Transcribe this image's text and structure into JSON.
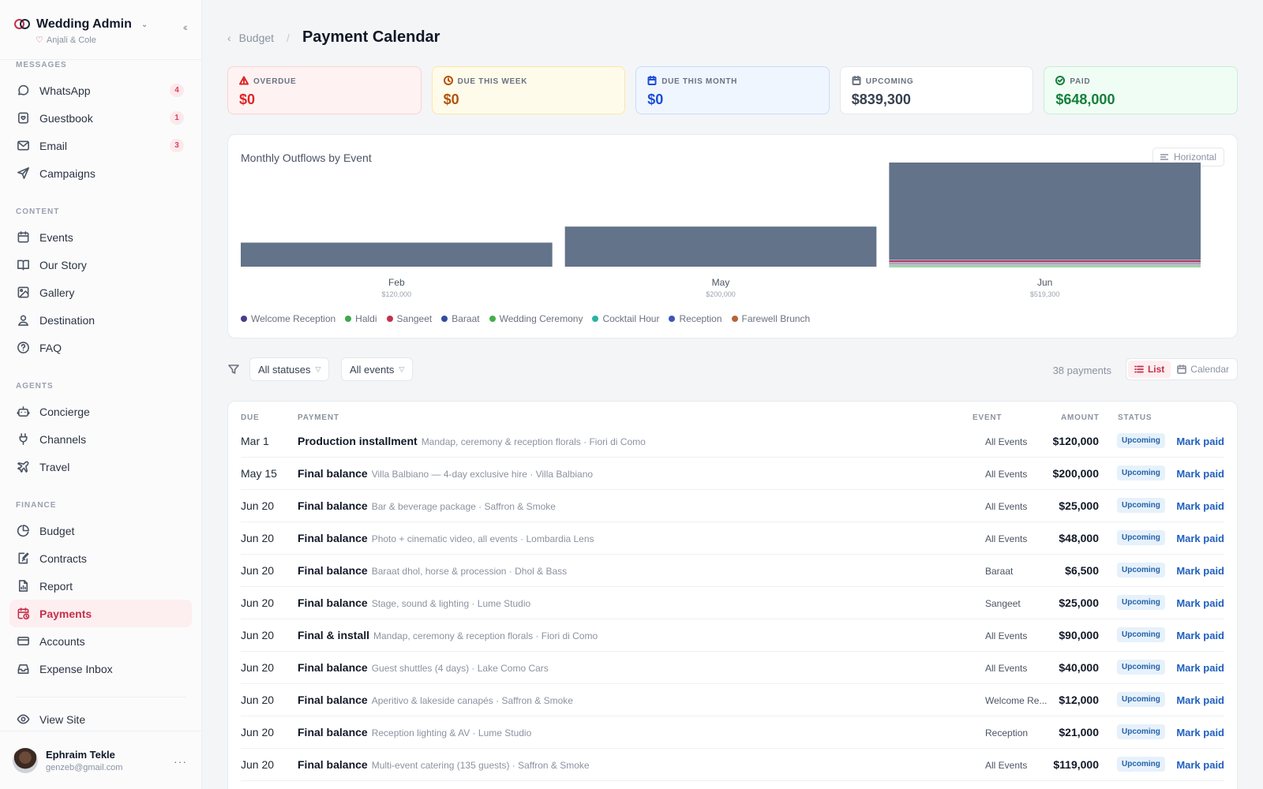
{
  "sidebar": {
    "brand": "Wedding Admin",
    "couple": "Anjali & Cole",
    "sections": [
      {
        "label": "MESSAGES",
        "items": [
          {
            "label": "WhatsApp",
            "icon": "message-circle-icon",
            "badge": "4"
          },
          {
            "label": "Guestbook",
            "icon": "guestbook-icon",
            "badge": "1"
          },
          {
            "label": "Email",
            "icon": "mail-icon",
            "badge": "3"
          },
          {
            "label": "Campaigns",
            "icon": "send-icon"
          }
        ]
      },
      {
        "label": "CONTENT",
        "items": [
          {
            "label": "Events",
            "icon": "calendar-icon"
          },
          {
            "label": "Our Story",
            "icon": "book-icon"
          },
          {
            "label": "Gallery",
            "icon": "image-icon"
          },
          {
            "label": "Destination",
            "icon": "map-pin-icon"
          },
          {
            "label": "FAQ",
            "icon": "help-circle-icon"
          }
        ]
      },
      {
        "label": "AGENTS",
        "items": [
          {
            "label": "Concierge",
            "icon": "bot-icon"
          },
          {
            "label": "Channels",
            "icon": "plug-icon"
          },
          {
            "label": "Travel",
            "icon": "plane-icon"
          }
        ]
      },
      {
        "label": "FINANCE",
        "items": [
          {
            "label": "Budget",
            "icon": "pie-chart-icon"
          },
          {
            "label": "Contracts",
            "icon": "file-signature-icon"
          },
          {
            "label": "Report",
            "icon": "file-chart-icon"
          },
          {
            "label": "Payments",
            "icon": "calendar-clock-icon",
            "active": true
          },
          {
            "label": "Accounts",
            "icon": "credit-card-icon"
          },
          {
            "label": "Expense Inbox",
            "icon": "inbox-icon"
          }
        ]
      }
    ],
    "view_site": "View Site",
    "user": {
      "name": "Ephraim Tekle",
      "email": "genzeb@gmail.com"
    }
  },
  "header": {
    "breadcrumb": "Budget",
    "title": "Payment Calendar"
  },
  "stats": [
    {
      "key": "overdue",
      "label": "OVERDUE",
      "value": "$0",
      "icon": "alert-triangle-icon"
    },
    {
      "key": "week",
      "label": "DUE THIS WEEK",
      "value": "$0",
      "icon": "clock-icon"
    },
    {
      "key": "month",
      "label": "DUE THIS MONTH",
      "value": "$0",
      "icon": "calendar-icon"
    },
    {
      "key": "upcoming",
      "label": "UPCOMING",
      "value": "$839,300",
      "icon": "calendar-icon"
    },
    {
      "key": "paid",
      "label": "PAID",
      "value": "$648,000",
      "icon": "check-circle-icon"
    }
  ],
  "chart": {
    "title": "Monthly Outflows by Event",
    "orientation_label": "Horizontal"
  },
  "chart_data": {
    "type": "bar",
    "stacked": true,
    "title": "Monthly Outflows by Event",
    "categories": [
      "Feb",
      "May",
      "Jun"
    ],
    "category_totals": [
      "$120,000",
      "$200,000",
      "$519,300"
    ],
    "series": [
      {
        "name": "Welcome Reception",
        "color": "#4a3b8f",
        "values": [
          0,
          0,
          2000
        ]
      },
      {
        "name": "Haldi",
        "color": "#3fa84a",
        "values": [
          0,
          0,
          2000
        ]
      },
      {
        "name": "Sangeet",
        "color": "#c4314b",
        "values": [
          0,
          0,
          12000
        ]
      },
      {
        "name": "Baraat",
        "color": "#2f4e9c",
        "values": [
          0,
          0,
          4000
        ]
      },
      {
        "name": "Wedding Ceremony",
        "color": "#43b04a",
        "values": [
          0,
          0,
          4000
        ]
      },
      {
        "name": "Cocktail Hour",
        "color": "#2bb3a3",
        "values": [
          0,
          0,
          4000
        ]
      },
      {
        "name": "Reception",
        "color": "#3c55b8",
        "values": [
          0,
          0,
          4000
        ]
      },
      {
        "name": "Farewell Brunch",
        "color": "#b5653a",
        "values": [
          0,
          0,
          2000
        ]
      },
      {
        "name": "All Events",
        "color": "#637389",
        "values": [
          120000,
          200000,
          485300
        ]
      }
    ],
    "legend": [
      "Welcome Reception",
      "Haldi",
      "Sangeet",
      "Baraat",
      "Wedding Ceremony",
      "Cocktail Hour",
      "Reception",
      "Farewell Brunch"
    ],
    "ylim": [
      0,
      519300
    ],
    "grid": false,
    "legend_position": "bottom"
  },
  "filters": {
    "status": "All statuses",
    "event": "All events",
    "count": "38 payments",
    "list": "List",
    "calendar": "Calendar"
  },
  "table": {
    "headers": {
      "due": "DUE",
      "payment": "PAYMENT",
      "event": "EVENT",
      "amount": "AMOUNT",
      "status": "STATUS"
    },
    "action_label": "Mark paid",
    "rows": [
      {
        "due": "Mar 1",
        "title": "Production installment",
        "desc": "Mandap, ceremony & reception florals · Fiori di Como",
        "event": "All Events",
        "amount": "$120,000",
        "status": "Upcoming"
      },
      {
        "due": "May 15",
        "title": "Final balance",
        "desc": "Villa Balbiano — 4-day exclusive hire · Villa Balbiano",
        "event": "All Events",
        "amount": "$200,000",
        "status": "Upcoming"
      },
      {
        "due": "Jun 20",
        "title": "Final balance",
        "desc": "Bar & beverage package · Saffron & Smoke",
        "event": "All Events",
        "amount": "$25,000",
        "status": "Upcoming"
      },
      {
        "due": "Jun 20",
        "title": "Final balance",
        "desc": "Photo + cinematic video, all events · Lombardia Lens",
        "event": "All Events",
        "amount": "$48,000",
        "status": "Upcoming"
      },
      {
        "due": "Jun 20",
        "title": "Final balance",
        "desc": "Baraat dhol, horse & procession · Dhol & Bass",
        "event": "Baraat",
        "amount": "$6,500",
        "status": "Upcoming"
      },
      {
        "due": "Jun 20",
        "title": "Final balance",
        "desc": "Stage, sound & lighting · Lume Studio",
        "event": "Sangeet",
        "amount": "$25,000",
        "status": "Upcoming"
      },
      {
        "due": "Jun 20",
        "title": "Final & install",
        "desc": "Mandap, ceremony & reception florals · Fiori di Como",
        "event": "All Events",
        "amount": "$90,000",
        "status": "Upcoming"
      },
      {
        "due": "Jun 20",
        "title": "Final balance",
        "desc": "Guest shuttles (4 days) · Lake Como Cars",
        "event": "All Events",
        "amount": "$40,000",
        "status": "Upcoming"
      },
      {
        "due": "Jun 20",
        "title": "Final balance",
        "desc": "Aperitivo & lakeside canapés · Saffron & Smoke",
        "event": "Welcome Re...",
        "amount": "$12,000",
        "status": "Upcoming"
      },
      {
        "due": "Jun 20",
        "title": "Final balance",
        "desc": "Reception lighting & AV · Lume Studio",
        "event": "Reception",
        "amount": "$21,000",
        "status": "Upcoming"
      },
      {
        "due": "Jun 20",
        "title": "Final balance",
        "desc": "Multi-event catering (135 guests) · Saffron & Smoke",
        "event": "All Events",
        "amount": "$119,000",
        "status": "Upcoming"
      }
    ]
  }
}
